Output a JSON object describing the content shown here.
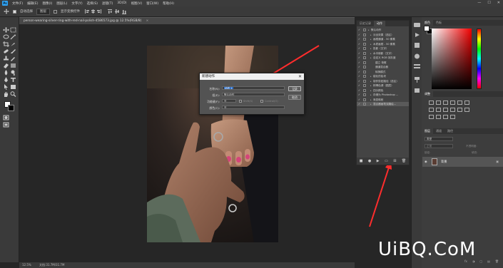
{
  "menubar": {
    "logo": "Ps",
    "items": [
      "文件(F)",
      "编辑(E)",
      "图像(I)",
      "图层(L)",
      "文字(Y)",
      "选择(S)",
      "滤镜(T)",
      "3D(D)",
      "视图(V)",
      "窗口(W)",
      "帮助(H)"
    ],
    "minimize": "—",
    "maximize": "☐",
    "close": "✕"
  },
  "options": {
    "auto_select_label": "自动选择",
    "auto_select_value": "图层",
    "transform_label": "显示变换控件"
  },
  "document": {
    "tab_title": "person-wearing-silver-ring-with-red-nail-polish-4586573.jpg @ 12.5%(RGB/8)",
    "close_icon": "×",
    "status": "12.5%",
    "doc_info": "文档:31.7M/31.7M"
  },
  "actions_panel": {
    "tabs": [
      "历史记录",
      "动作"
    ],
    "rows": [
      {
        "label": "默认动作",
        "level": 0
      },
      {
        "label": "淡出效果（选区）",
        "level": 1
      },
      {
        "label": "画框通道 - 50 像素",
        "level": 1
      },
      {
        "label": "木质画框 - 50 像素",
        "level": 1
      },
      {
        "label": "投影（文字）",
        "level": 1
      },
      {
        "label": "水中倒影（文字）",
        "level": 1
      },
      {
        "label": "自定义 RGB 到灰度",
        "level": 1
      },
      {
        "label": "熔化的铅块",
        "level": 1
      },
      {
        "label": "制作剪贴路径（选区）",
        "level": 1
      },
      {
        "label": "棕褐色调（图层）",
        "level": 1
      },
      {
        "label": "四分颜色",
        "level": 1
      },
      {
        "label": "存储为 Photoshop ...",
        "level": 1
      },
      {
        "label": "渐变映射",
        "level": 1
      },
      {
        "label": "混合器画笔克隆绘...",
        "level": 1
      }
    ],
    "sub_rows": [
      "建立 快照",
      "通道混合器",
      "转换模式"
    ],
    "bottom_icons": [
      "stop-icon",
      "record-icon",
      "play-icon",
      "new-set-icon",
      "new-action-icon",
      "delete-icon"
    ]
  },
  "dialog": {
    "title": "新建动作",
    "close": "✕",
    "name_label": "名称(N):",
    "name_value": "动作 1",
    "set_label": "组(E):",
    "set_value": "默认动作",
    "fkey_label": "功能键(F):",
    "fkey_value": "无",
    "shift_label": "Shift(S)",
    "control_label": "Control(O)",
    "color_label": "颜色(C):",
    "color_value": "无",
    "ok": "记录",
    "cancel": "取消"
  },
  "right_panels": {
    "color_tabs": [
      "颜色",
      "色板"
    ],
    "adjust_tab": "调整",
    "layers_tabs": [
      "图层",
      "通道",
      "路径"
    ],
    "layer_kind": "类型",
    "blend_mode": "正常",
    "opacity_label": "不透明度:",
    "lock_label": "锁定:",
    "fill_label": "填充:",
    "layer_name": "背景",
    "footer_icons": [
      "fx",
      "◑",
      "▢",
      "▤",
      "🗑"
    ]
  },
  "watermark": "UiBQ.CoM",
  "colors": {
    "accent": "#2fa3f5",
    "arrow": "#ff2d2d",
    "panel": "#444444"
  }
}
